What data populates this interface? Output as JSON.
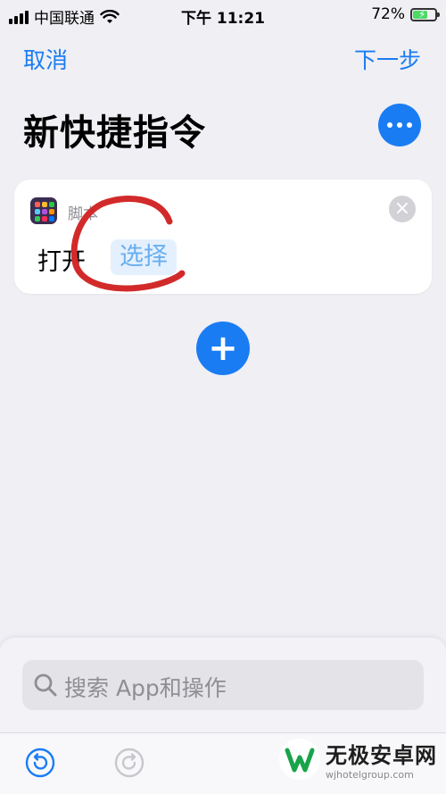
{
  "status_bar": {
    "carrier": "中国联通",
    "time": "下午 11:21",
    "battery_text": "72%",
    "battery_level": 0.72,
    "signal_bars": 4,
    "icons": [
      "signal-icon",
      "wifi-icon",
      "battery-charging-icon"
    ]
  },
  "nav": {
    "cancel_label": "取消",
    "next_label": "下一步",
    "accent_color": "#1a7cf3"
  },
  "page": {
    "title": "新快捷指令",
    "more_icon": "ellipsis-icon"
  },
  "action_card": {
    "app_icon": "scripting-app-icon",
    "app_name": "脚本",
    "verb": "打开",
    "parameter_placeholder": "选择",
    "close_icon": "close-icon"
  },
  "add_button": {
    "icon": "plus-icon"
  },
  "search": {
    "placeholder": "搜索 App和操作",
    "icon": "search-icon"
  },
  "toolbar": {
    "undo_icon": "undo-icon",
    "redo_icon": "redo-icon"
  },
  "watermark": {
    "title": "无极安卓网",
    "url": "wjhotelgroup.com"
  }
}
